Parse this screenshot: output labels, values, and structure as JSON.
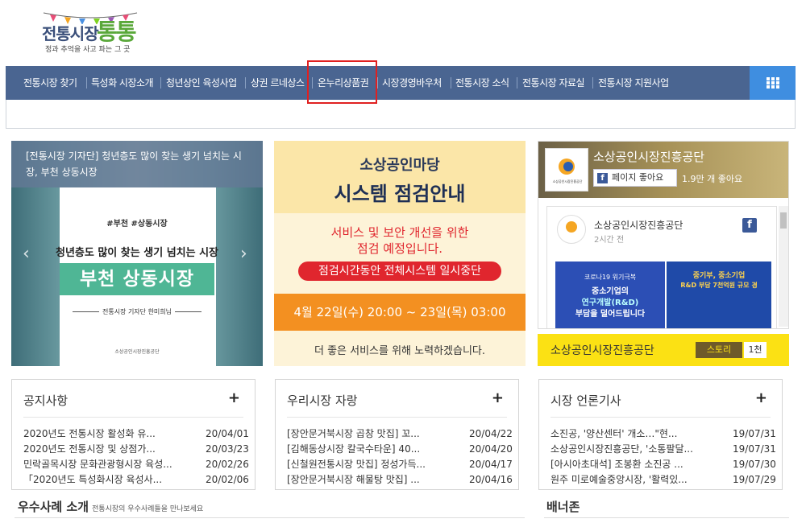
{
  "logo": {
    "main": "전통시장",
    "accent": "통통",
    "tagline": "정과 추억을 사고 파는 그 곳"
  },
  "nav": {
    "items": [
      "전통시장 찾기",
      "특성화 시장소개",
      "청년상인 육성사업",
      "상권 르네상스",
      "온누리상품권",
      "시장경영바우처",
      "전통시장 소식",
      "전통시장 자료실",
      "전통시장 지원사업"
    ],
    "highlighted": "온누리상품권",
    "menu_icon": "grid-menu-icon"
  },
  "slider": {
    "caption": "[전통시장 기자단] 청년층도 많이 찾는 생기 넘치는 시장, 부천 상동시장",
    "tag": "#부천 #상동시장",
    "headline": "청년층도 많이 찾는 생기 넘치는 시장",
    "big": "부천 상동시장",
    "byline": "전통시장 기자단 한미희님",
    "org": "소상공인시장진흥공단",
    "prev_icon": "chevron-left-icon",
    "next_icon": "chevron-right-icon"
  },
  "notice_banner": {
    "line1": "소상공인마당",
    "line2": "시스템 점검안내",
    "line3": "서비스 및 보안 개선을 위한",
    "line4": "점검 예정입니다.",
    "pill": "점검시간동안 전체시스템 일시중단",
    "date": "4월 22일(수) 20:00 ~ 23일(목) 03:00",
    "footer": "더 좋은 서비스를 위해 노력하겠습니다."
  },
  "facebook": {
    "page_name": "소상공인시장진흥공단",
    "like_label": "페이지 좋아요",
    "likes": "1.9만 개 좋아요",
    "post_author": "소상공인시장진흥공단",
    "post_time": "2시간 전",
    "img1_text1": "코로나19 위기극복",
    "img1_text2": "중소기업의",
    "img1_text3": "연구개발(R&D)",
    "img1_text4": "부담을 덜어드립니다",
    "img2_text1": "중기부, 중소기업",
    "img2_text2": "R&D 부담 7천억원 규모 경"
  },
  "story": {
    "title": "소상공인시장진흥공단",
    "badge": "스토리",
    "count": "1천"
  },
  "boxes": [
    {
      "title": "공지사항",
      "items": [
        {
          "t": "2020년도 전통시장 활성화 유...",
          "d": "20/04/01"
        },
        {
          "t": "2020년도 전통시장 및 상점가...",
          "d": "20/03/23"
        },
        {
          "t": "민락골목시장 문화관광형시장 육성...",
          "d": "20/02/26"
        },
        {
          "t": "「2020년도 특성화시장 육성사...",
          "d": "20/02/06"
        }
      ]
    },
    {
      "title": "우리시장 자랑",
      "items": [
        {
          "t": "[장안문거북시장 곱창 맛집] 꼬...",
          "d": "20/04/22"
        },
        {
          "t": "[김해동상시장 칼국수타운] 40...",
          "d": "20/04/20"
        },
        {
          "t": "[신철원전통시장 맛집] 정성가득...",
          "d": "20/04/17"
        },
        {
          "t": "[장안문거북시장 해물탕 맛집] ...",
          "d": "20/04/16"
        }
      ]
    },
    {
      "title": "시장 언론기사",
      "items": [
        {
          "t": "소진공, '양산센터' 개소…\"현...",
          "d": "19/07/31"
        },
        {
          "t": "소상공인시장진흥공단, '소통팔달...",
          "d": "19/07/31"
        },
        {
          "t": "[아시아초대석] 조봉환 소진공 ...",
          "d": "19/07/30"
        },
        {
          "t": "원주 미로예술중앙시장, '활력있...",
          "d": "19/07/29"
        }
      ]
    }
  ],
  "bottom": {
    "left_title": "우수사례 소개",
    "left_sub": "전통시장의 우수사례들을 만나보세요",
    "right_title": "배너존"
  },
  "colors": {
    "nav": "#4a6591",
    "grid_button": "#3f8ee0",
    "highlight": "#e02020",
    "story": "#fbe114"
  }
}
